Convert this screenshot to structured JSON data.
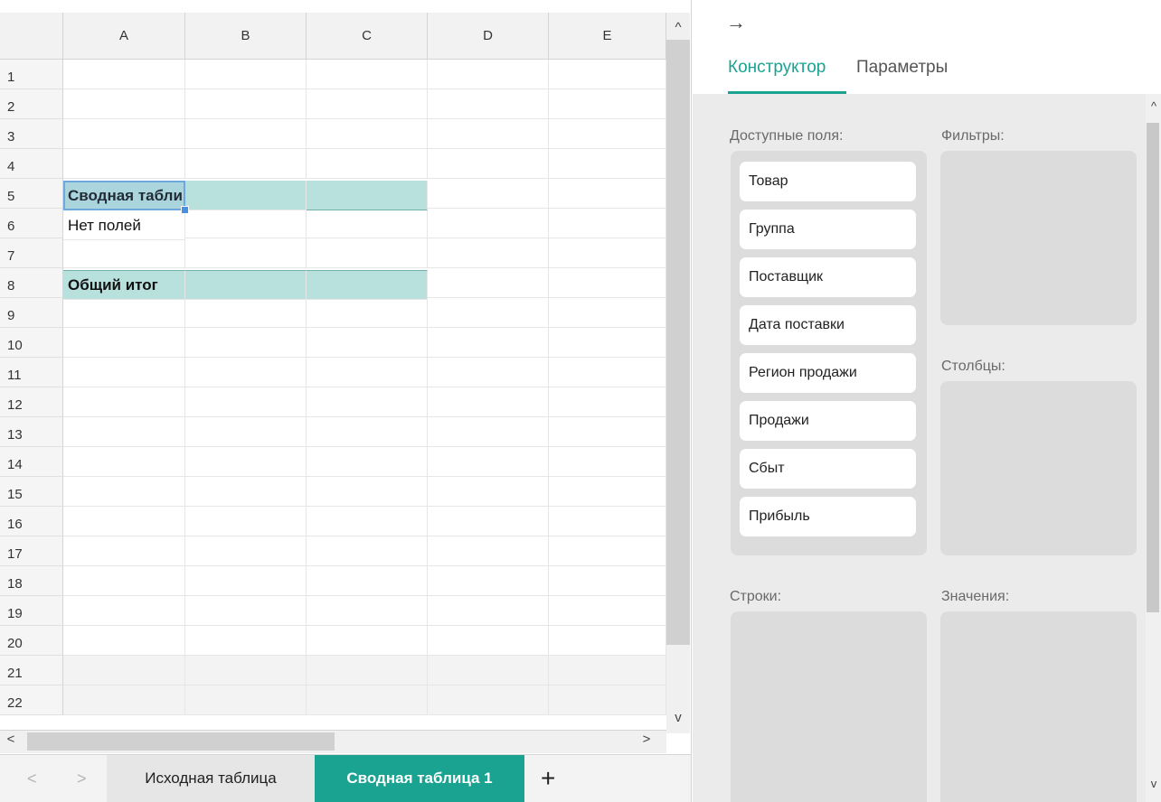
{
  "spreadsheet": {
    "columns": [
      "A",
      "B",
      "C",
      "D",
      "E"
    ],
    "rows": [
      "1",
      "2",
      "3",
      "4",
      "5",
      "6",
      "7",
      "8",
      "9",
      "10",
      "11",
      "12",
      "13",
      "14",
      "15",
      "16",
      "17",
      "18",
      "19",
      "20",
      "21",
      "22"
    ],
    "cells": {
      "a5": "Сводная таблица",
      "a6": "Нет полей",
      "a8": "Общий итог"
    }
  },
  "scroll": {
    "up": "^",
    "down": "v",
    "left": "<",
    "right": ">"
  },
  "sheet_tabs": {
    "prev": "<",
    "next": ">",
    "tabs": [
      "Исходная таблица",
      "Сводная таблица 1"
    ],
    "active_index": 1,
    "add": "+"
  },
  "panel": {
    "collapse_icon": "→",
    "tabs": [
      "Конструктор",
      "Параметры"
    ],
    "active_tab": "Конструктор",
    "available_label": "Доступные поля:",
    "fields": [
      "Товар",
      "Группа",
      "Поставщик",
      "Дата поставки",
      "Регион продажи",
      "Продажи",
      "Сбыт",
      "Прибыль"
    ],
    "filters_label": "Фильтры:",
    "columns_label": "Столбцы:",
    "rows_label": "Строки:",
    "values_label": "Значения:"
  },
  "colors": {
    "accent": "#1ba392",
    "pivot_fill": "#b8e0dd",
    "selection": "#6fa8dc"
  }
}
